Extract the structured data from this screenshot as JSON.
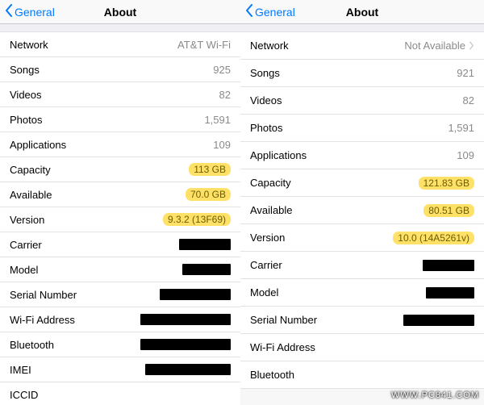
{
  "nav": {
    "back_label": "General",
    "title": "About"
  },
  "left": {
    "network": {
      "label": "Network",
      "value": "AT&T Wi-Fi"
    },
    "songs": {
      "label": "Songs",
      "value": "925"
    },
    "videos": {
      "label": "Videos",
      "value": "82"
    },
    "photos": {
      "label": "Photos",
      "value": "1,591"
    },
    "applications": {
      "label": "Applications",
      "value": "109"
    },
    "capacity": {
      "label": "Capacity",
      "value": "113 GB",
      "highlight": true
    },
    "available": {
      "label": "Available",
      "value": "70.0 GB",
      "highlight": true
    },
    "version": {
      "label": "Version",
      "value": "9.3.2 (13F69)",
      "highlight": true
    },
    "carrier": {
      "label": "Carrier",
      "redact_w": 64
    },
    "model": {
      "label": "Model",
      "redact_w": 60
    },
    "serial": {
      "label": "Serial Number",
      "redact_w": 88
    },
    "wifi": {
      "label": "Wi-Fi Address",
      "redact_w": 112
    },
    "bluetooth": {
      "label": "Bluetooth",
      "redact_w": 112
    },
    "imei": {
      "label": "IMEI",
      "redact_w": 106
    },
    "iccid": {
      "label": "ICCID",
      "redact_w": 0
    }
  },
  "right": {
    "network": {
      "label": "Network",
      "value": "Not Available",
      "chevron": true
    },
    "songs": {
      "label": "Songs",
      "value": "921"
    },
    "videos": {
      "label": "Videos",
      "value": "82"
    },
    "photos": {
      "label": "Photos",
      "value": "1,591"
    },
    "applications": {
      "label": "Applications",
      "value": "109"
    },
    "capacity": {
      "label": "Capacity",
      "value": "121.83 GB",
      "highlight": true
    },
    "available": {
      "label": "Available",
      "value": "80.51 GB",
      "highlight": true
    },
    "version": {
      "label": "Version",
      "value": "10.0 (14A5261v)",
      "highlight": true
    },
    "carrier": {
      "label": "Carrier",
      "redact_w": 64
    },
    "model": {
      "label": "Model",
      "redact_w": 60
    },
    "serial": {
      "label": "Serial Number",
      "redact_w": 88
    },
    "wifi": {
      "label": "Wi-Fi Address",
      "redact_w": 0
    },
    "bluetooth": {
      "label": "Bluetooth",
      "redact_w": 0
    }
  },
  "watermark": "WWW.PC841.COM"
}
